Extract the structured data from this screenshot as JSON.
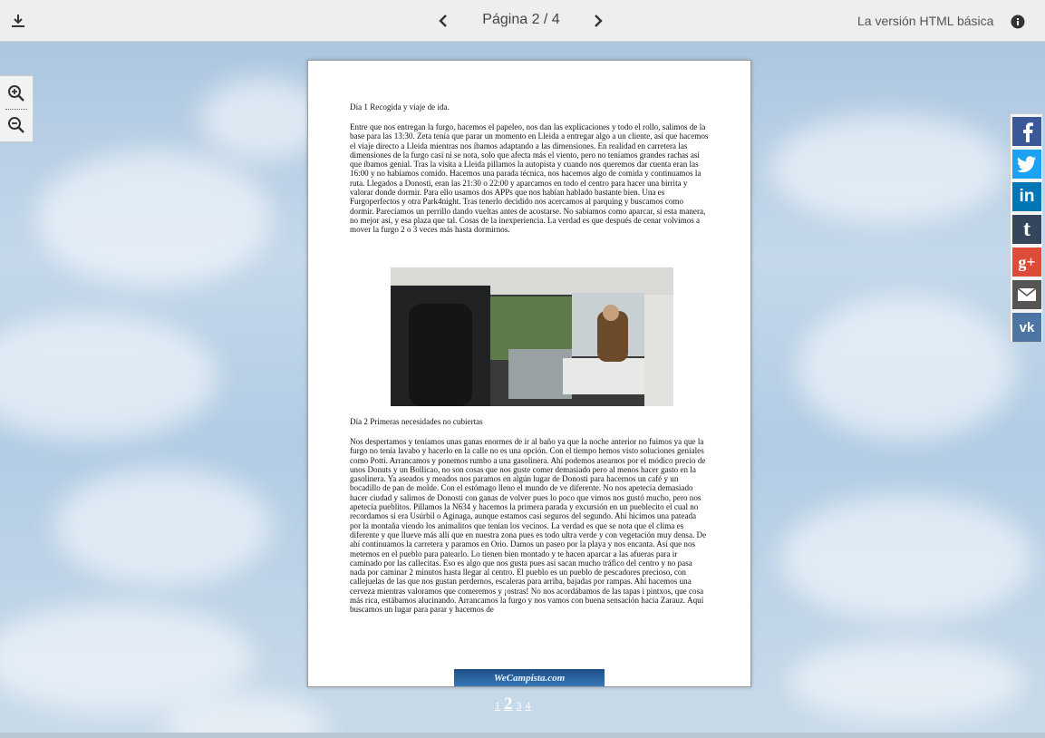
{
  "toolbar": {
    "download_icon": "download-icon",
    "prev_icon": "chevron-left-icon",
    "next_icon": "chevron-right-icon",
    "page_label": "Página 2 / 4",
    "basic_html_label": "La versión HTML básica",
    "info_icon": "info-icon"
  },
  "zoom": {
    "zoom_in_icon": "zoom-in-icon",
    "zoom_out_icon": "zoom-out-icon"
  },
  "document": {
    "heading1": "Día 1 Recogida y viaje de ida.",
    "para1": "Entre que nos entregan la furgo, hacemos el papeleo, nos dan las explicaciones y todo el rollo, salimos de la base para las 13:30. Zeta tenía que parar un momento en Lleida a entregar algo a un cliente, así que hacemos el viaje directo a Lleida mientras nos íbamos adaptando a las dimensiones. En realidad en carretera las dimensiones de la furgo casi ni se nota, solo que afecta más el viento, pero no teníamos grandes rachas así que íbamos genial. Tras la visita a Lleida pillamos la autopista y cuando nos queremos dar cuenta eran las 16:00 y no habíamos comido. Hacemos una parada técnica, nos hacemos algo de comida y continuamos la ruta. Llegados a Donosti, eran las 21:30 o 22:00 y aparcamos en todo el centro para hacer una birrita y valorar donde dormir. Para ello usamos dos APPs que nos habían hablado bastante bien. Una es Furgoperfectos y otra Park4night. Tras tenerlo decidido nos acercamos al parquing y buscamos como dormir. Parecíamos un perrillo dando vueltas antes de acostarse. No sabíamos como aparcar, si esta manera, no mejor así, y esa plaza que tal. Cosas de la inexperiencia. La verdad es que después de cenar volvimos a mover la furgo 2 o 3 veces más hasta dormirnos.",
    "heading2": "Día 2 Primeras necesidades no cubiertas",
    "para2": "Nos despertamos y teníamos unas ganas enormes de ir al baño ya que la noche anterior no fuimos ya que la furgo no tenía lavabo y hacerlo en la calle no es una opción. Con el tiempo hemos visto soluciones geniales como Potti. Arrancamos y ponemos rumbo a una gasolinera. Ahí podemos asearnos por el módico precio de unos Donuts y un Bollicao, no son cosas que nos guste comer demasiado pero al menos hacer gasto en la gasolinera. Ya aseados y meados nos paramos en algún lugar de Donosti para hacernos un café y un bocadillo de pan de molde. Con el estómago lleno el mundo de ve diferente. No nos apetecía demasiado hacer ciudad y salimos de Donosti con ganas de volver pues lo poco que vimos nos gustó mucho, pero nos apetecía pueblitos. Pillamos la N634 y hacemos la primera parada y excursión en un pueblecito el cual no recordamos si era Usúrbil o Aginaga, aunque estamos casi seguros del segundo. Ahí hicimos una pateada por la montaña viendo los animalitos que tenían los vecinos. La verdad es que se nota que el clima es diferente y que llueve más allí que en nuestra zona pues es todo ultra verde y con vegetación muy densa. De ahí continuamos la carretera y paramos en Orio. Damos un paseo por la playa y nos encanta. Así que nos metemos en el pueblo para patearlo. Lo tienen bien montado y te hacen aparcar a las afueras para ir caminado por las callecitas. Eso es algo que nos gusta pues así sacan mucho tráfico del centro y no pasa nada por caminar 2 minutos hasta llegar al centro. El pueblo es un pueblo de pescadores precioso, con callejuelas de las que nos gustan perdernos, escaleras para arriba, bajadas por rampas. Ahí hacemos una cerveza mientras valoramos que comeremos y ¡ostras! No nos acordábamos de las tapas i pintxos, que cosa más rica, estábamos alucinando. Arrancamos la furgo y nos vamos con buena sensación hacia Zarauz. Aquí buscamos un lugar para parar y hacemos de",
    "logo_text": "WeCampista.com"
  },
  "pager": {
    "pages": [
      "1",
      "2",
      "3",
      "4"
    ],
    "current": "2"
  },
  "social": [
    {
      "name": "facebook",
      "glyph": "f",
      "color": "#3b5998"
    },
    {
      "name": "twitter",
      "glyph": "t",
      "color": "#1da1f2"
    },
    {
      "name": "linkedin",
      "glyph": "in",
      "color": "#0077b5"
    },
    {
      "name": "tumblr",
      "glyph": "t",
      "color": "#35465c"
    },
    {
      "name": "google-plus",
      "glyph": "g+",
      "color": "#dd4b39"
    },
    {
      "name": "email",
      "glyph": "✉",
      "color": "#555555"
    },
    {
      "name": "vk",
      "glyph": "vk",
      "color": "#4c75a3"
    }
  ]
}
